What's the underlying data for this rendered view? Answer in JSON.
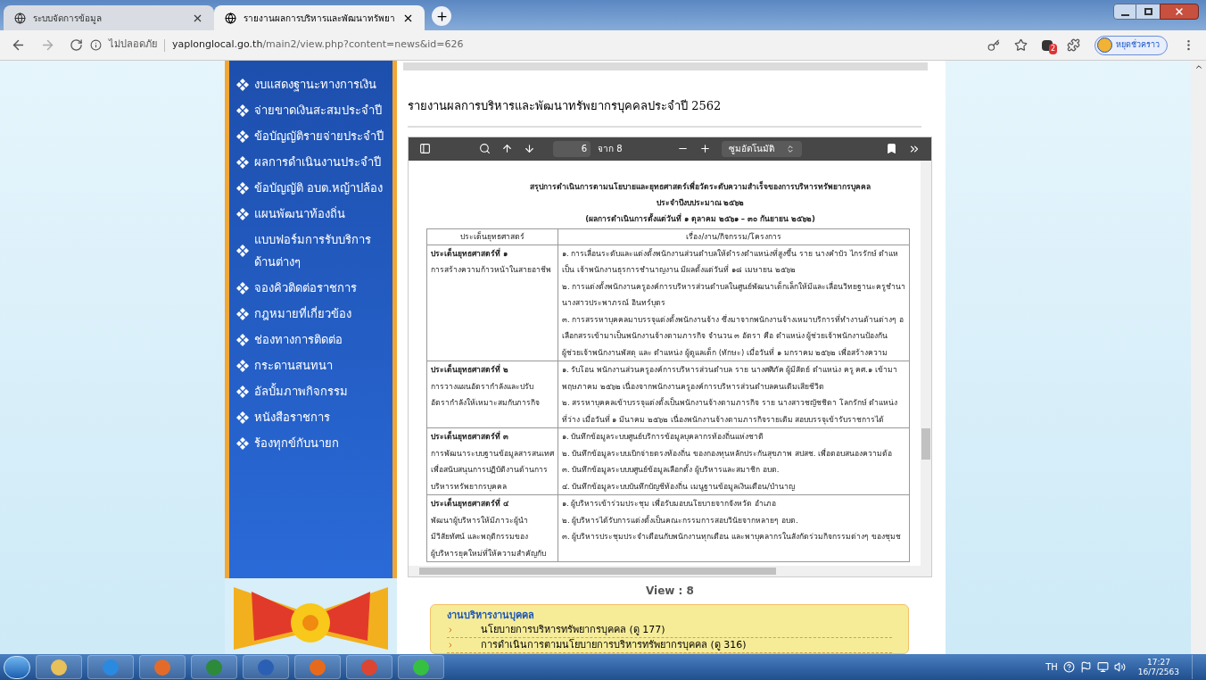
{
  "browser": {
    "tabs": [
      {
        "title": "ระบบจัดการข้อมูล",
        "selected": false
      },
      {
        "title": "รายงานผลการบริหารและพัฒนาทรัพยา",
        "selected": true
      }
    ],
    "url": {
      "security": "ไม่ปลอดภัย",
      "host": "yaplonglocal.go.th",
      "path": "/main2/view.php?content=news&id=626"
    },
    "extension_badge": "2",
    "profile_button": "หยุดชั่วคราว"
  },
  "sidebar": {
    "items": [
      "งบแสดงฐานะทางการเงิน",
      "จ่ายขาดเงินสะสมประจำปี",
      "ข้อบัญญัติรายจ่ายประจำปี",
      "ผลการดำเนินงานประจำปี",
      "ข้อบัญญัติ อบต.หญ้าปล้อง",
      "แผนพัฒนาท้องถิ่น",
      "แบบฟอร์มการรับบริการด้านต่างๆ",
      "จองคิวติดต่อราชการ",
      "กฎหมายที่เกี่ยวข้อง",
      "ช่องทางการติดต่อ",
      "กระดานสนทนา",
      "อัลบั้มภาพกิจกรรม",
      "หนังสือราชการ",
      "ร้องทุกข์กับนายก"
    ]
  },
  "article": {
    "title": "รายงานผลการบริหารและพัฒนาทรัพยากรบุคคลประจำปี 2562",
    "pdf_viewer": {
      "page": "6",
      "page_total": "จาก 8",
      "zoom": "ซูมอัตโนมัติ",
      "heading": [
        "สรุปการดำเนินการตามนโยบายและยุทธศาสตร์เพื่อวัดระดับความสำเร็จของการบริหารทรัพยากรบุคคล",
        "ประจำปีงบประมาณ  ๒๕๖๒",
        "(ผลการดำเนินการตั้งแต่วันที่ ๑ ตุลาคม  ๒๕๖๑ – ๓๐ กันยายน ๒๕๖๒)"
      ],
      "columns": [
        "ประเด็นยุทธศาสตร์",
        "เรื่อง/งาน/กิจกรรม/โครงการ"
      ],
      "rows": [
        {
          "title": "ประเด็นยุทธศาสตร์ที่ ๑",
          "subtitle": [
            "การสร้างความก้าวหน้าในสายอาชีพ"
          ],
          "lines": [
            "๑. การเลื่อนระดับและแต่งตั้งพนักงานส่วนตำบลให้ดำรงตำแหน่งที่สูงขึ้น ราย นางคำบัว  ไกรรักษ์  ตำแห",
            "เป็น เจ้าพนักงานธุรการชำนาญงาน  มีผลตั้งแต่วันที่  ๑๘ เมษายน ๒๕๖๒",
            "๒. การแต่งตั้งพนักงานครูองค์การบริหารส่วนตำบลในศูนย์พัฒนาเด็กเล็กให้มีและเลื่อนวิทยฐานะครูชำนา",
            "นางสาวประพาภรณ์  อินทร์บุตร",
            "๓. การสรรหาบุคคลมาบรรจุแต่งตั้งพนักงานจ้าง  ซึ่งมาจากพนักงานจ้างเหมาบริการที่ทำงานด้านต่างๆ อ",
            "เลือกสรรเข้ามาเป็นพนักงานจ้างตามภารกิจ   จำนวน  ๓ อัตรา คือ  ตำแหน่ง  ผู้ช่วยเจ้าพนักงานป้องกัน",
            "ผู้ช่วยเจ้าพนักงานพัสดุ  และ ตำแหน่ง  ผู้ดูแลเด็ก (ทักษะ)  เมื่อวันที่  ๑ มกราคม ๒๕๖๒  เพื่อสร้างความ"
          ]
        },
        {
          "title": "ประเด็นยุทธศาสตร์ที่ ๒",
          "subtitle": [
            "การวางแผนอัตรากำลังและปรับ",
            "อัตรากำลังให้เหมาะสมกับภารกิจ"
          ],
          "lines": [
            "๑. รับโอน พนักงานส่วนครูองค์การบริหารส่วนตำบล ราย นางศศิภัค  ผู้มีสัตย์  ตำแหน่ง ครู คศ.๑  เข้ามา",
            "พฤษภาคม ๒๕๖๒  เนื่องจากพนักงานครูองค์การบริหารส่วนตำบลคนเดิมเสียชีวิต",
            "๒. สรรหาบุคคลเข้าบรรจุแต่งตั้งเป็นพนักงานจ้างตามภารกิจ  ราย นางสาวชญัชชิดา  โลกรักษ์  ตำแหน่ง",
            "ที่ว่าง  เมื่อวันที่  ๑ มีนาคม ๒๕๖๒  เนื่องพนักงานจ้างตามภารกิจรายเดิม  สอบบรรจุเข้ารับราชการได้"
          ]
        },
        {
          "title": "ประเด็นยุทธศาสตร์ที่ ๓",
          "subtitle": [
            "การพัฒนาระบบฐานข้อมูลสารสนเทศ",
            "เพื่อสนับสนุนการปฏิบัติงานด้านการ",
            "บริหารทรัพยากรบุคคล"
          ],
          "lines": [
            "๑. บันทึกข้อมูลระบบศูนย์บริการข้อมูลบุคลากรท้องถิ่นแห่งชาติ",
            "๒. บันทึกข้อมูลระบบเบิกจ่ายตรงท้องถิ่น ของกองทุนหลักประกันสุขภาพ  สปสช. เพื่อตอบสนองความต้อ",
            "๓. บันทึกข้อมูลระบบบศูนย์ข้อมูลเลือกตั้ง  ผู้บริหารและสมาชิก อบต.",
            "๔. บันทึกข้อมูลระบบบันทึกบัญชีท้องถิ่น เมนูฐานข้อมูลเงินเดือน/บำนาญ"
          ]
        },
        {
          "title": "ประเด็นยุทธศาสตร์ที่ ๔",
          "subtitle": [
            "พัฒนาผู้บริหารให้มีภาวะผู้นำ",
            "มีวิสัยทัศน์ และพฤติกรรมของ",
            "ผู้บริหารยุคใหม่ที่ให้ความสำคัญกับ"
          ],
          "lines": [
            "๑. ผู้บริหารเข้าร่วมประชุม เพื่อรับมอบนโยบายจากจังหวัด อำเภอ",
            "๒. ผู้บริหารได้รับการแต่งตั้งเป็นคณะกรรมการสอบวินัยจากหลายๆ อบต.",
            "๓. ผู้บริหารประชุมประจำเดือนกับพนักงานทุกเดือน  และพาบุคลากรในสังกัดร่วมกิจกรรมต่างๆ ของชุมช"
          ]
        }
      ]
    },
    "view_count": "View : 8",
    "related": {
      "title": "งานบริหารงานบุคคล",
      "links": [
        "นโยบายการบริหารทรัพยากรบุคคล  (ดู 177)",
        "การดำเนินการตามนโยบายการบริหารทรัพยากรบุคคล  (ดู 316)"
      ]
    }
  },
  "taskbar": {
    "language": "TH",
    "time": "17:27",
    "date": "16/7/2563"
  }
}
